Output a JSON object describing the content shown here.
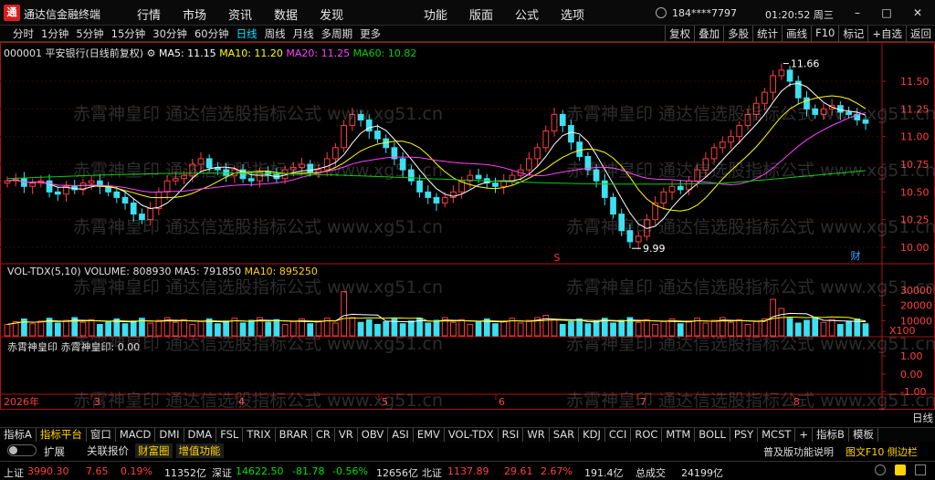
{
  "app": {
    "title": "通达信金融终端",
    "logo": "通",
    "menu_left": [
      "行情",
      "市场",
      "资讯",
      "数据",
      "发现"
    ],
    "menu_right": [
      "功能",
      "版面",
      "公式",
      "选项"
    ],
    "user_id": "184****7797",
    "clock": "01:20:52 周三",
    "window_buttons": [
      "–",
      "□",
      "✕"
    ]
  },
  "toolbar": {
    "periods": [
      "分时",
      "1分钟",
      "5分钟",
      "15分钟",
      "30分钟",
      "60分钟",
      "日线",
      "周线",
      "月线",
      "多周期",
      "更多"
    ],
    "active_period": "日线",
    "tools": [
      "复权",
      "叠加",
      "多股",
      "统计",
      "画线",
      "F10",
      "标记",
      "+自选",
      "返回"
    ]
  },
  "price_panel": {
    "stock_code": "000001",
    "stock_name": "平安银行(日线前复权)",
    "ma5_label": "MA5: 11.15",
    "ma10_label": "MA10: 11.20",
    "ma20_label": "MA20: 11.25",
    "ma60_label": "MA60: 10.82",
    "y_ticks": [
      "11.50",
      "11.25",
      "11.00",
      "10.75",
      "10.50",
      "10.25",
      "10.00"
    ],
    "high_label": "11.66",
    "low_label": "9.99",
    "marker_s": "S",
    "marker_cai": "财"
  },
  "volume_panel": {
    "label": "VOL-TDX(5,10)",
    "volume": "VOLUME: 808930",
    "ma5": "MA5: 791850",
    "ma10": "MA10: 895250",
    "y_ticks": [
      "30000",
      "20000",
      "10000"
    ],
    "unit": "X100"
  },
  "indicator_panel": {
    "label": "赤霄神皇印",
    "value": "赤霄神皇印: 0.00",
    "y_ticks": [
      "1.00",
      "0.00",
      "-1.00"
    ]
  },
  "x_axis": {
    "year": "2026年",
    "months": [
      "3",
      "4",
      "5",
      "6",
      "7",
      "8"
    ]
  },
  "watermark_text": "赤霄神皇印 通达信选股指标公式 www.xg51.cn",
  "indicator_tabs": [
    "指标A",
    "指标平台",
    "窗口",
    "MACD",
    "DMI",
    "DMA",
    "FSL",
    "TRIX",
    "BRAR",
    "CR",
    "VR",
    "OBV",
    "ASI",
    "EMV",
    "VOL-TDX",
    "RSI",
    "WR",
    "SAR",
    "KDJ",
    "CCI",
    "ROC",
    "MTM",
    "BOLL",
    "PSY",
    "MCST",
    "+",
    "指标B",
    "模板"
  ],
  "active_indicator_tab": "指标平台",
  "daily_label": "日线",
  "expand_row": {
    "label": "扩展",
    "items": [
      "关联报价",
      "财富圈",
      "增值功能"
    ],
    "hint": "普及版功能说明",
    "hint2": "图文F10 侧边栏"
  },
  "statusbar": {
    "sh_label": "上证",
    "sh_value": "3990.30",
    "sh_change": "7.65",
    "sh_pct": "0.19%",
    "sh_amount": "11352亿",
    "sz_label": "深证",
    "sz_value": "14622.50",
    "sz_change": "-81.78",
    "sz_pct": "-0.56%",
    "sz_amount": "12656亿",
    "bz_label": "北证",
    "bz_value": "1137.89",
    "bz_change": "29.61",
    "bz_pct": "2.67%",
    "bz_amount": "191.4亿",
    "total_label": "总成交",
    "total_value": "24199亿"
  },
  "colors": {
    "up": "#ff3c3c",
    "down": "#3ce0f0",
    "ma5": "#ffffff",
    "ma10": "#ffff00",
    "ma20": "#ff40ff",
    "ma60": "#00d000"
  }
}
